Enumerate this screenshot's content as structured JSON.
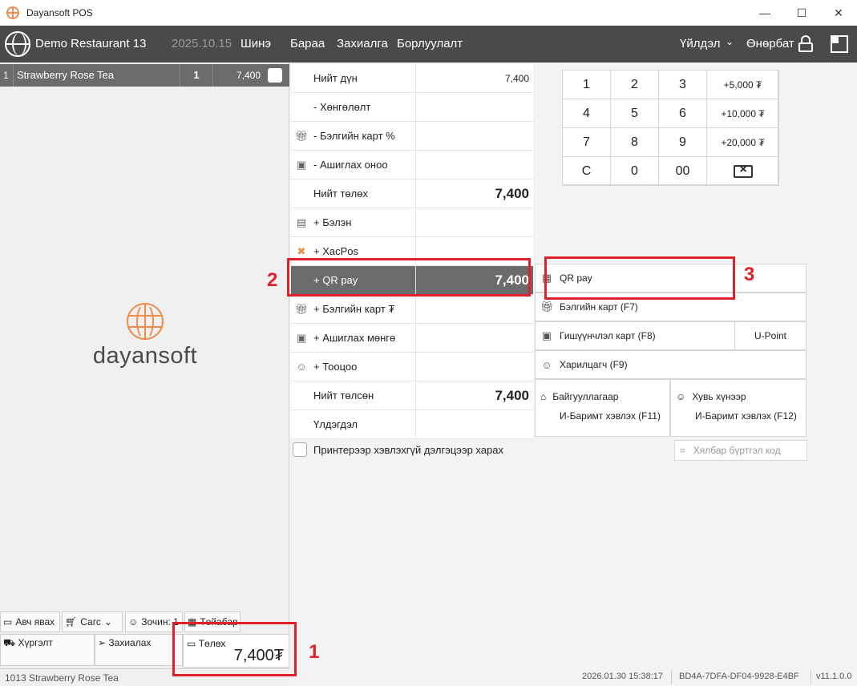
{
  "window": {
    "title": "Dayansoft POS",
    "min": "—",
    "max": "☐",
    "close": "✕"
  },
  "nav": {
    "restaurant": "Demo Restaurant 13",
    "date": "2025.10.15",
    "items": [
      "Шинэ",
      "Бараа",
      "Захиалга",
      "Борлуулалт"
    ],
    "operations": "Үйлдэл",
    "user": "Өнөрбат"
  },
  "order": {
    "row": {
      "no": "1",
      "name": "Strawberry Rose Tea",
      "qty": "1",
      "price": "7,400"
    }
  },
  "logo": {
    "word": "dayansoft"
  },
  "left_buttons": {
    "takeaway": "Авч явах",
    "basket": "Сагс",
    "guest": "Зочин: 1",
    "table": "Төйабар",
    "delivery": "Хүргэлт",
    "order": "Захиалах",
    "pay_label": "Төлөх",
    "pay_amount": "7,400₮"
  },
  "status_left": "1013 Strawberry Rose Tea",
  "summary": [
    {
      "icon": "",
      "label": "Нийт дүн",
      "value": "7,400",
      "big": false
    },
    {
      "icon": "",
      "label": "- Хөнгөлөлт",
      "value": "",
      "big": false
    },
    {
      "icon": "gift-icon",
      "label": "- Бэлгийн карт %",
      "value": "",
      "big": false
    },
    {
      "icon": "member-icon",
      "label": "- Ашиглах оноо",
      "value": "",
      "big": false
    },
    {
      "icon": "",
      "label": "Нийт төлөх",
      "value": "7,400",
      "big": true
    },
    {
      "icon": "cash-icon",
      "label": "+ Бэлэн",
      "value": "",
      "big": false
    },
    {
      "icon": "xacpos-icon",
      "label": "+ XacPos",
      "value": "",
      "big": false
    },
    {
      "icon": "",
      "label": "+ QR pay",
      "value": "7,400",
      "big": true,
      "active": true
    },
    {
      "icon": "gift-icon",
      "label": "+ Бэлгийн карт ₮",
      "value": "",
      "big": false
    },
    {
      "icon": "member-icon",
      "label": "+ Ашиглах мөнгө",
      "value": "",
      "big": false
    },
    {
      "icon": "person-icon",
      "label": "+ Тооцоо",
      "value": "",
      "big": false
    },
    {
      "icon": "",
      "label": "Нийт төлсөн",
      "value": "7,400",
      "big": true
    },
    {
      "icon": "",
      "label": "Үлдэгдэл",
      "value": "",
      "big": false
    }
  ],
  "printer_option": "Принтерээр хэвлэхгүй дэлгэцээр харах",
  "keypad": [
    "1",
    "2",
    "3",
    "+5,000 ₮",
    "4",
    "5",
    "6",
    "+10,000 ₮",
    "7",
    "8",
    "9",
    "+20,000 ₮",
    "C",
    "0",
    "00",
    ""
  ],
  "methods": {
    "qr": "QR pay",
    "gift": "Бэлгийн карт (F7)",
    "member": "Гишүүнчлэл карт (F8)",
    "upoint": "U-Point",
    "customer": "Харилцагч (F9)",
    "org_line1": "Байгууллагаар",
    "org_line2": "И-Баримт хэвлэх (F11)",
    "person_line1": "Хувь хүнээр",
    "person_line2": "И-Баримт хэвлэх (F12)"
  },
  "scan_placeholder": "Хялбар бүртгэл код",
  "status": {
    "datetime": "2026.01.30 15:38:17",
    "device": "BD4A-7DFA-DF04-9928-E4BF",
    "version": "v11.1.0.0"
  },
  "annotations": [
    "1",
    "2",
    "3"
  ],
  "colors": {
    "accent": "#f08c4a",
    "nav_bg": "#4a4a4a",
    "active_row": "#6b6b6b",
    "annotation": "#e0202a"
  }
}
